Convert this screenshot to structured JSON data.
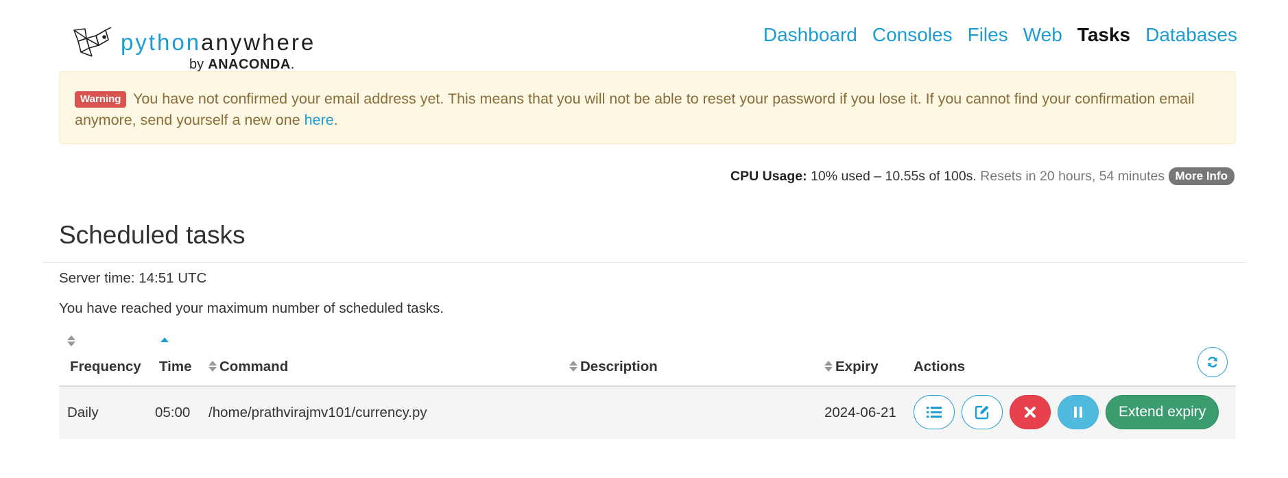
{
  "brand": {
    "name_part1": "python",
    "name_part2": "anywhere",
    "by": "by",
    "company": "ANACONDA",
    "company_dot": "."
  },
  "nav": {
    "items": [
      {
        "label": "Dashboard",
        "active": false
      },
      {
        "label": "Consoles",
        "active": false
      },
      {
        "label": "Files",
        "active": false
      },
      {
        "label": "Web",
        "active": false
      },
      {
        "label": "Tasks",
        "active": true
      },
      {
        "label": "Databases",
        "active": false
      }
    ]
  },
  "alert": {
    "badge": "Warning",
    "text": "You have not confirmed your email address yet. This means that you will not be able to reset your password if you lose it. If you cannot find your confirmation email anymore, send yourself a new one ",
    "link": "here",
    "end": "."
  },
  "cpu": {
    "label": "CPU Usage:",
    "value": "10% used – 10.55s of 100s.",
    "resets": "Resets in 20 hours, 54 minutes",
    "more_info": "More Info"
  },
  "page": {
    "title": "Scheduled tasks",
    "server_time": "Server time: 14:51 UTC",
    "max_message": "You have reached your maximum number of scheduled tasks."
  },
  "table": {
    "headers": {
      "frequency": "Frequency",
      "time": "Time",
      "command": "Command",
      "description": "Description",
      "expiry": "Expiry",
      "actions": "Actions"
    },
    "rows": [
      {
        "frequency": "Daily",
        "time": "05:00",
        "command": "/home/prathvirajmv101/currency.py",
        "description": "",
        "expiry": "2024-06-21",
        "extend_label": "Extend expiry"
      }
    ]
  },
  "colors": {
    "link": "#1d9cd3",
    "warning_bg": "#fcf8e3",
    "danger": "#e8414e",
    "info": "#4fb9de",
    "success": "#3a9c6f"
  }
}
